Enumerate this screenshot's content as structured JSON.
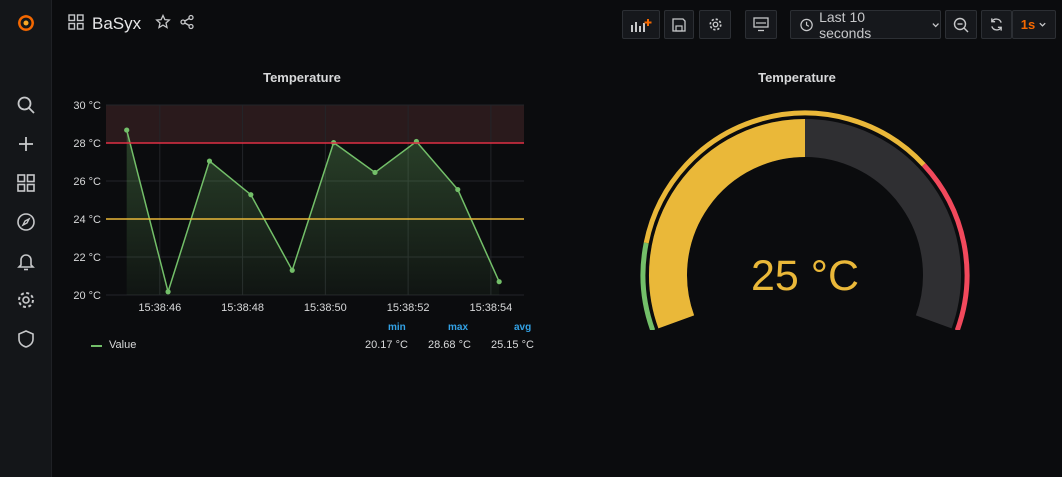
{
  "dashboard": {
    "title": "BaSyx"
  },
  "toolbar": {
    "time_range": "Last 10 seconds",
    "refresh_interval": "1s"
  },
  "sidebar": {
    "items": [
      {
        "icon": "search-icon"
      },
      {
        "icon": "plus-icon"
      },
      {
        "icon": "dashboards-icon"
      },
      {
        "icon": "explore-icon"
      },
      {
        "icon": "bell-icon"
      },
      {
        "icon": "gear-icon"
      },
      {
        "icon": "shield-icon"
      }
    ]
  },
  "graph_panel": {
    "title": "Temperature",
    "legend": {
      "headers": {
        "min": "min",
        "max": "max",
        "avg": "avg"
      },
      "series_name": "Value",
      "min": "20.17 °C",
      "max": "28.68 °C",
      "avg": "25.15 °C"
    }
  },
  "gauge_panel": {
    "title": "Temperature",
    "value_text": "25 °C",
    "value": 25,
    "min": 18,
    "max": 32,
    "thresholds": [
      {
        "from": 18,
        "to": 20,
        "color": "#73bf69"
      },
      {
        "from": 20,
        "to": 28,
        "color": "#eab839"
      },
      {
        "from": 28,
        "to": 32,
        "color": "#f2495c"
      }
    ],
    "value_color": "#eab839"
  },
  "chart_data": {
    "type": "line",
    "title": "Temperature",
    "series": [
      {
        "name": "Value",
        "color": "#73bf69",
        "points": [
          [
            "15:38:45.2",
            28.68
          ],
          [
            "15:38:46.2",
            20.17
          ],
          [
            "15:38:47.2",
            27.05
          ],
          [
            "15:38:48.2",
            25.28
          ],
          [
            "15:38:49.2",
            21.3
          ],
          [
            "15:38:50.2",
            28.02
          ],
          [
            "15:38:51.2",
            26.45
          ],
          [
            "15:38:52.2",
            28.08
          ],
          [
            "15:38:53.2",
            25.55
          ],
          [
            "15:38:54.2",
            20.7
          ]
        ]
      }
    ],
    "x_ticks": [
      "15:38:46",
      "15:38:48",
      "15:38:50",
      "15:38:52",
      "15:38:54"
    ],
    "y_ticks": [
      "20 °C",
      "22 °C",
      "24 °C",
      "26 °C",
      "28 °C",
      "30 °C"
    ],
    "ylim": [
      20,
      30
    ],
    "threshold_lines": [
      {
        "value": 28,
        "color": "#e02f44"
      },
      {
        "value": 24,
        "color": "#eab839"
      }
    ],
    "grid": true,
    "legend_position": "bottom"
  }
}
